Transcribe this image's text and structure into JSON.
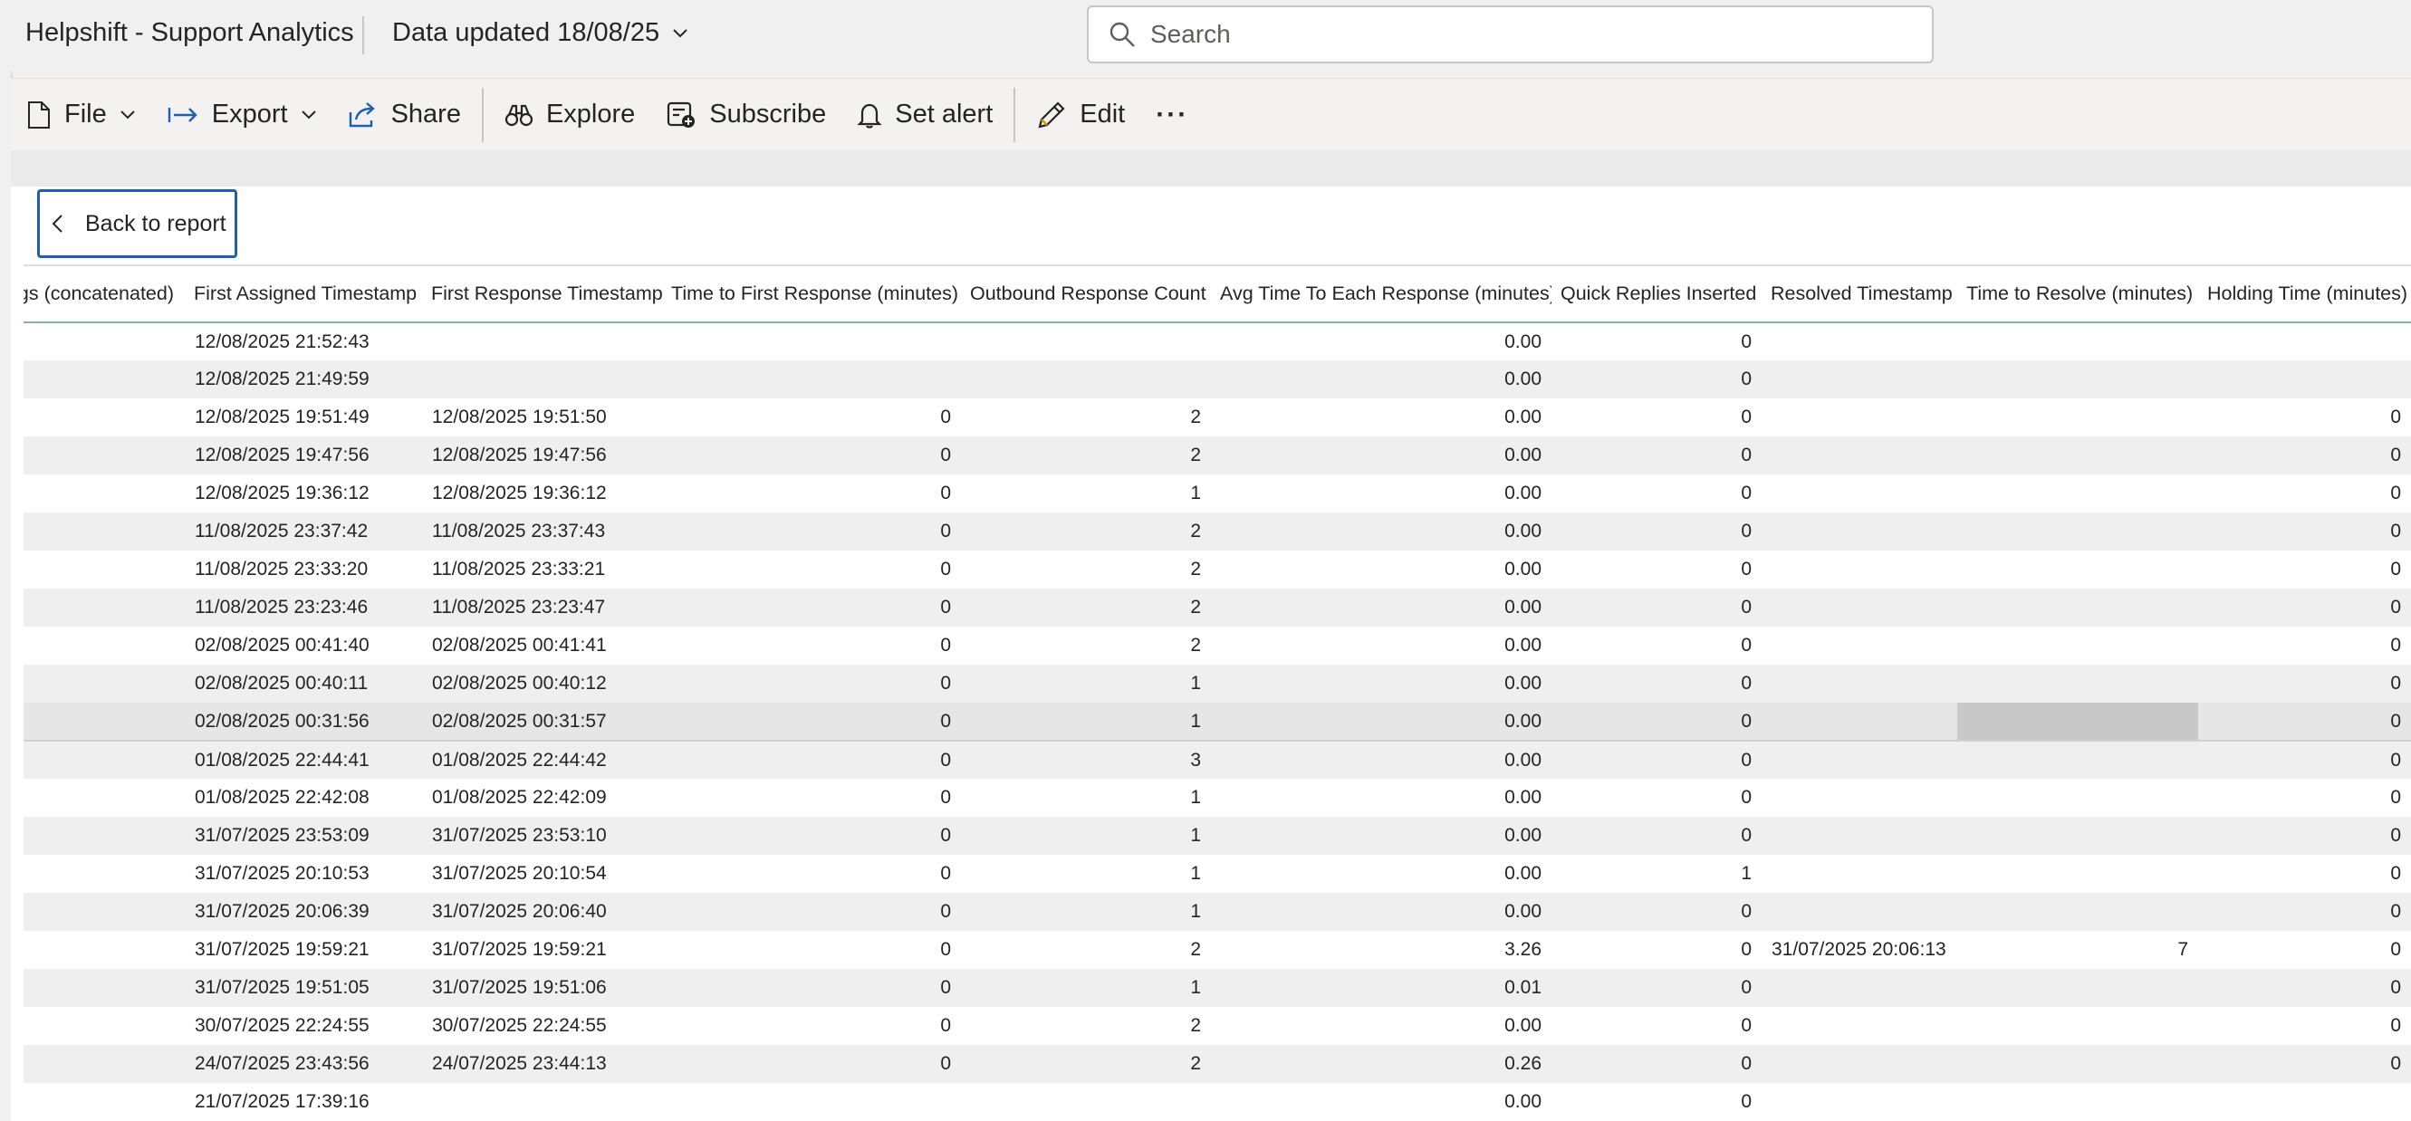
{
  "app": {
    "title": "Helpshift - Support Analytics",
    "data_updated": "Data updated 18/08/25"
  },
  "search": {
    "placeholder": "Search"
  },
  "toolbar": {
    "file": "File",
    "export": "Export",
    "share": "Share",
    "explore": "Explore",
    "subscribe": "Subscribe",
    "set_alert": "Set alert",
    "edit": "Edit",
    "more": "···"
  },
  "back_button": "Back to report",
  "table": {
    "columns": [
      "Tags (concatenated)",
      "First Assigned Timestamp",
      "First Response Timestamp",
      "Time to First Response (minutes)",
      "Outbound Response Count",
      "Avg Time To Each Response (minutes)",
      "Quick Replies Inserted",
      "Resolved Timestamp",
      "Time to Resolve (minutes)",
      "Holding Time (minutes)"
    ],
    "rows": [
      [
        "",
        "12/08/2025 21:52:43",
        "",
        "",
        "",
        "0.00",
        "0",
        "",
        "",
        ""
      ],
      [
        "",
        "12/08/2025 21:49:59",
        "",
        "",
        "",
        "0.00",
        "0",
        "",
        "",
        ""
      ],
      [
        "",
        "12/08/2025 19:51:49",
        "12/08/2025 19:51:50",
        "0",
        "2",
        "0.00",
        "0",
        "",
        "",
        "0"
      ],
      [
        "",
        "12/08/2025 19:47:56",
        "12/08/2025 19:47:56",
        "0",
        "2",
        "0.00",
        "0",
        "",
        "",
        "0"
      ],
      [
        "",
        "12/08/2025 19:36:12",
        "12/08/2025 19:36:12",
        "0",
        "1",
        "0.00",
        "0",
        "",
        "",
        "0"
      ],
      [
        "",
        "11/08/2025 23:37:42",
        "11/08/2025 23:37:43",
        "0",
        "2",
        "0.00",
        "0",
        "",
        "",
        "0"
      ],
      [
        "",
        "11/08/2025 23:33:20",
        "11/08/2025 23:33:21",
        "0",
        "2",
        "0.00",
        "0",
        "",
        "",
        "0"
      ],
      [
        "",
        "11/08/2025 23:23:46",
        "11/08/2025 23:23:47",
        "0",
        "2",
        "0.00",
        "0",
        "",
        "",
        "0"
      ],
      [
        "",
        "02/08/2025 00:41:40",
        "02/08/2025 00:41:41",
        "0",
        "2",
        "0.00",
        "0",
        "",
        "",
        "0"
      ],
      [
        "",
        "02/08/2025 00:40:11",
        "02/08/2025 00:40:12",
        "0",
        "1",
        "0.00",
        "0",
        "",
        "",
        "0"
      ],
      [
        "",
        "02/08/2025 00:31:56",
        "02/08/2025 00:31:57",
        "0",
        "1",
        "0.00",
        "0",
        "",
        "",
        "0"
      ],
      [
        "",
        "01/08/2025 22:44:41",
        "01/08/2025 22:44:42",
        "0",
        "3",
        "0.00",
        "0",
        "",
        "",
        "0"
      ],
      [
        "",
        "01/08/2025 22:42:08",
        "01/08/2025 22:42:09",
        "0",
        "1",
        "0.00",
        "0",
        "",
        "",
        "0"
      ],
      [
        "",
        "31/07/2025 23:53:09",
        "31/07/2025 23:53:10",
        "0",
        "1",
        "0.00",
        "0",
        "",
        "",
        "0"
      ],
      [
        "",
        "31/07/2025 20:10:53",
        "31/07/2025 20:10:54",
        "0",
        "1",
        "0.00",
        "1",
        "",
        "",
        "0"
      ],
      [
        "",
        "31/07/2025 20:06:39",
        "31/07/2025 20:06:40",
        "0",
        "1",
        "0.00",
        "0",
        "",
        "",
        "0"
      ],
      [
        "",
        "31/07/2025 19:59:21",
        "31/07/2025 19:59:21",
        "0",
        "2",
        "3.26",
        "0",
        "31/07/2025 20:06:13",
        "7",
        "0"
      ],
      [
        "",
        "31/07/2025 19:51:05",
        "31/07/2025 19:51:06",
        "0",
        "1",
        "0.01",
        "0",
        "",
        "",
        "0"
      ],
      [
        "",
        "30/07/2025 22:24:55",
        "30/07/2025 22:24:55",
        "0",
        "2",
        "0.00",
        "0",
        "",
        "",
        "0"
      ],
      [
        "",
        "24/07/2025 23:43:56",
        "24/07/2025 23:44:13",
        "0",
        "2",
        "0.26",
        "0",
        "",
        "",
        "0"
      ],
      [
        "",
        "21/07/2025 17:39:16",
        "",
        "",
        "",
        "0.00",
        "0",
        "",
        "",
        ""
      ]
    ],
    "selected_row": 10,
    "highlighted_cell": {
      "row": 10,
      "col": 8
    }
  },
  "colors": {
    "accent_border": "#1f5eb8",
    "header_underline": "#7fb6ac",
    "stripe": "#efefef"
  }
}
